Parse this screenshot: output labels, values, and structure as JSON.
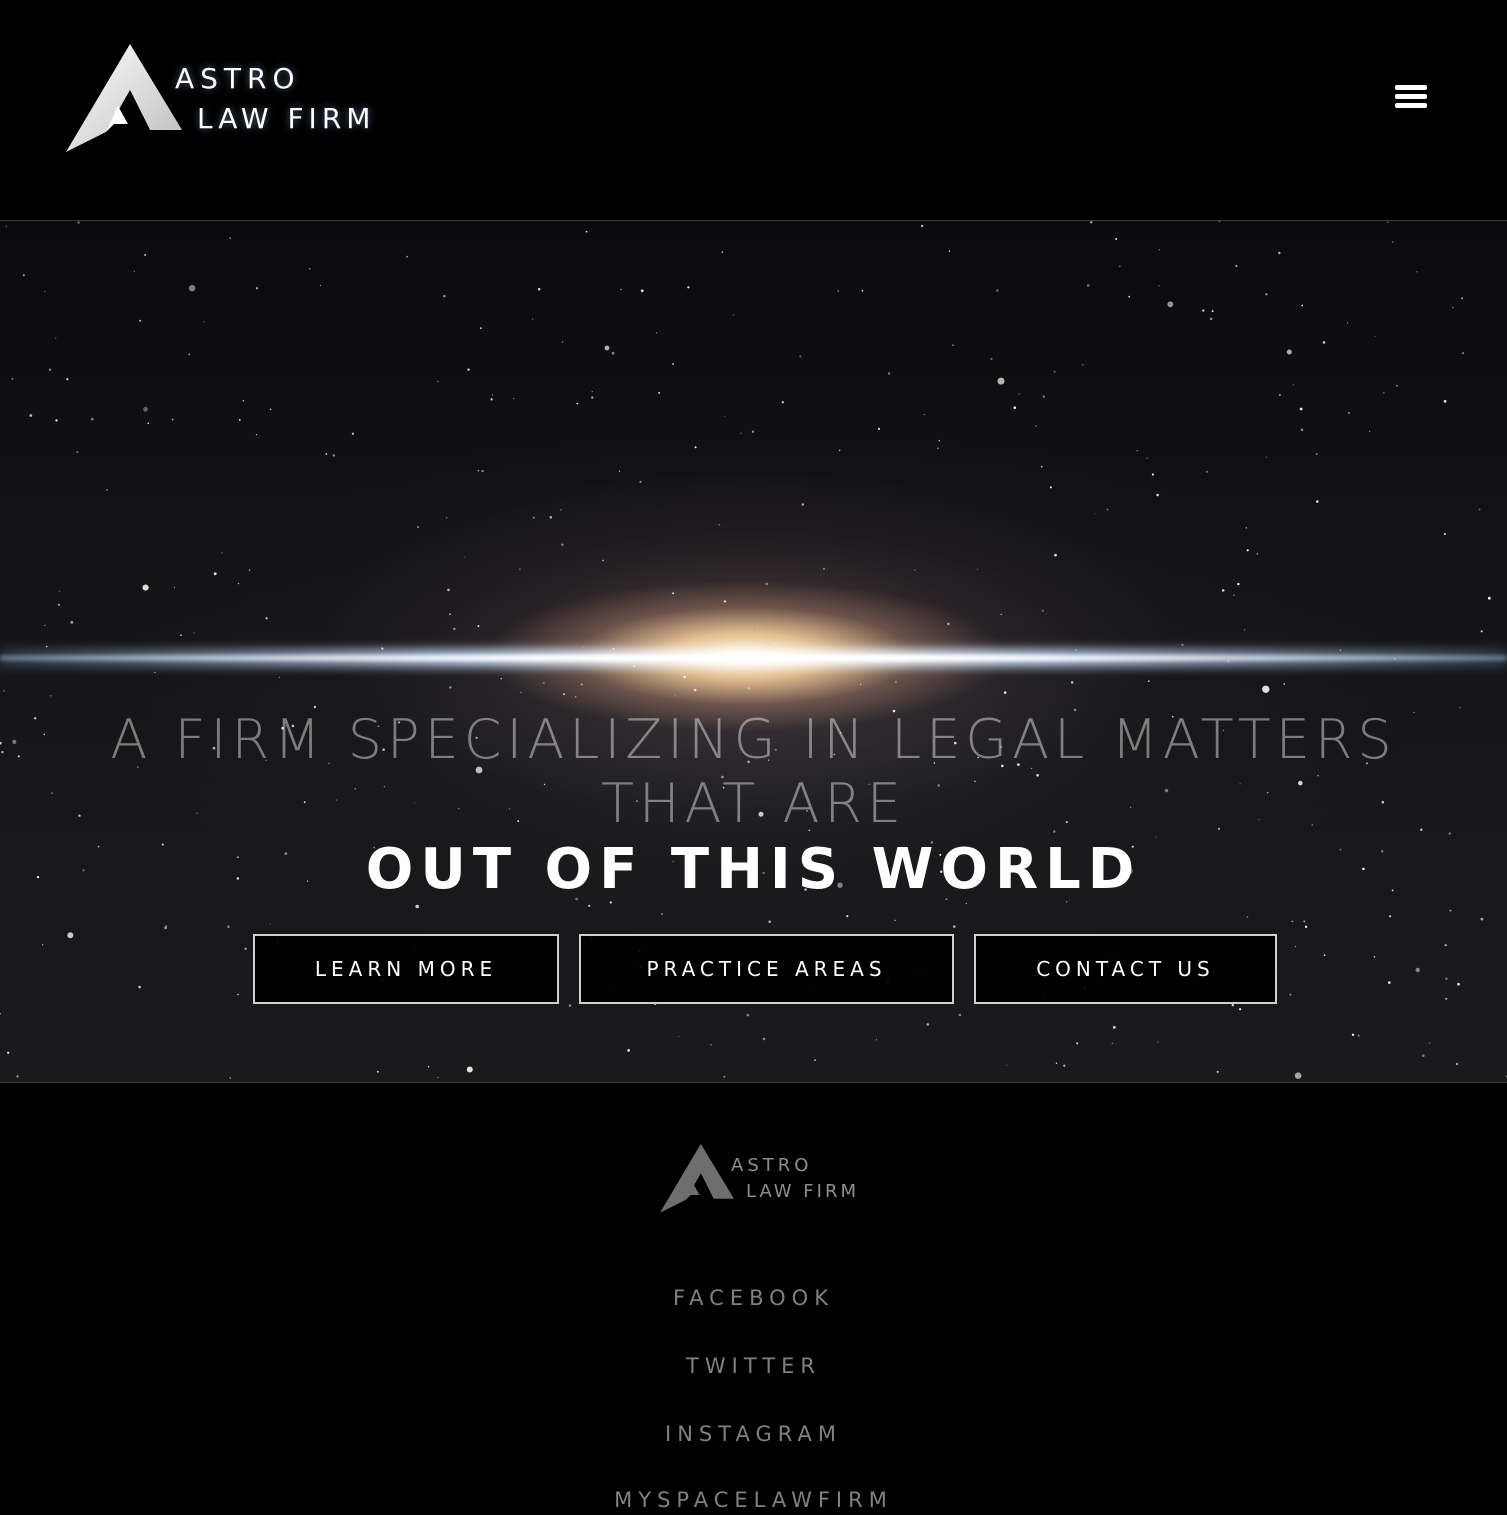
{
  "brand": {
    "name_line1": "ASTRO",
    "name_line2": "LAW FIRM",
    "logo_icon": "astro-a-logo-icon",
    "accent_color": "#ffffff"
  },
  "header": {
    "menu_icon": "hamburger-menu-icon"
  },
  "hero": {
    "headline_line1": "A FIRM SPECIALIZING IN LEGAL MATTERS",
    "headline_line2": "THAT ARE",
    "emphasis": "OUT OF THIS WORLD",
    "buttons": [
      {
        "label": "LEARN MORE"
      },
      {
        "label": "PRACTICE AREAS"
      },
      {
        "label": "CONTACT US"
      }
    ]
  },
  "footer": {
    "social_links": [
      {
        "label": "FACEBOOK"
      },
      {
        "label": "TWITTER"
      },
      {
        "label": "INSTAGRAM"
      },
      {
        "label": "MYSPACELAWFIRM"
      }
    ],
    "link_color": "#808080"
  }
}
